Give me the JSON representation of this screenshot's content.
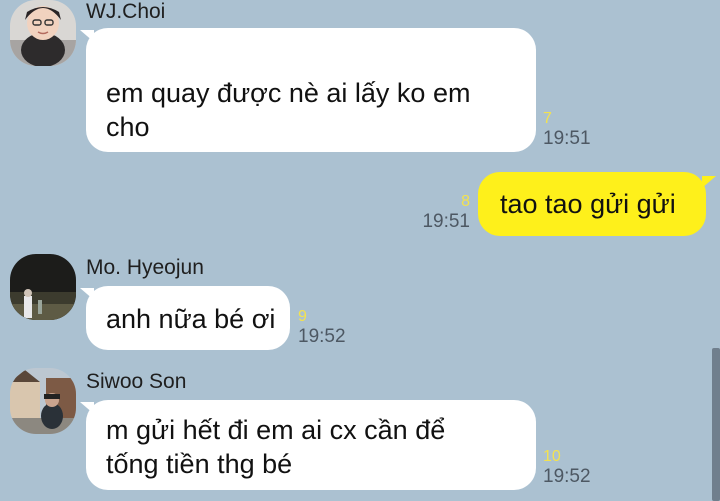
{
  "theme": {
    "background": "#abc1d1",
    "incoming_bubble": "#ffffff",
    "outgoing_bubble": "#fef01b",
    "unread_color": "#f3e24f",
    "time_color": "#4d5863"
  },
  "messages": [
    {
      "sender": "WJ.Choi",
      "avatar": "avatar-wj-choi",
      "lines": [
        "em quay được nè ai lấy ko em",
        "cho"
      ],
      "unread": "7",
      "time": "19:51",
      "direction": "incoming"
    },
    {
      "lines": [
        "tao tao gửi gửi"
      ],
      "unread": "8",
      "time": "19:51",
      "direction": "outgoing"
    },
    {
      "sender": "Mo. Hyeojun",
      "avatar": "avatar-mo-hyeojun",
      "lines": [
        "anh nữa bé ơi"
      ],
      "unread": "9",
      "time": "19:52",
      "direction": "incoming"
    },
    {
      "sender": "Siwoo Son",
      "avatar": "avatar-siwoo-son",
      "lines": [
        "m gửi hết đi em ai cx cần để",
        "tống tiền thg bé"
      ],
      "unread": "10",
      "time": "19:52",
      "direction": "incoming"
    }
  ]
}
